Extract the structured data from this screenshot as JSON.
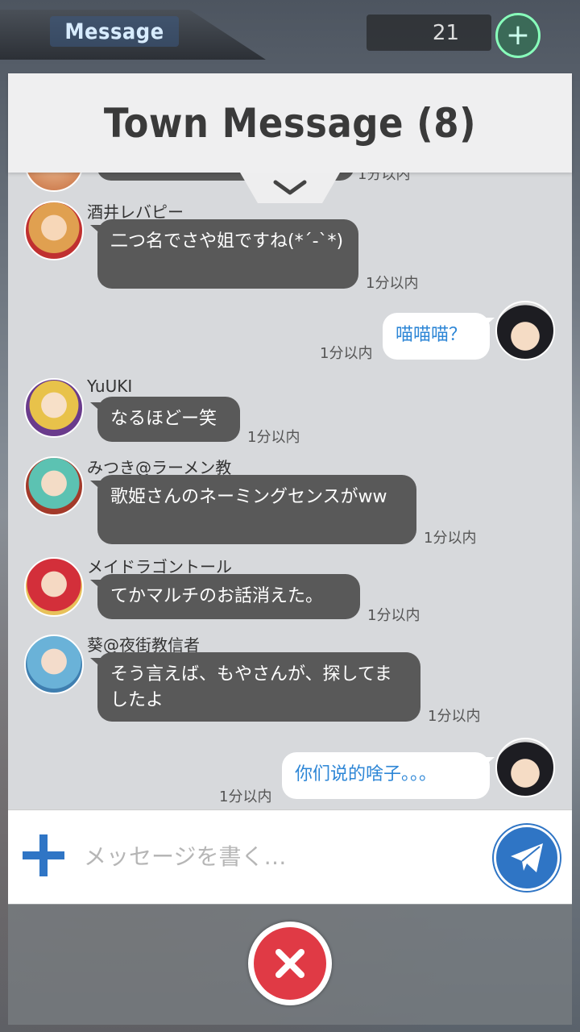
{
  "top_tab": {
    "label": "Message"
  },
  "top_counter": {
    "value": "21"
  },
  "header": {
    "title": "Town Message (8)"
  },
  "messages": [
    {
      "sender": "",
      "text": "",
      "time": "1分以内",
      "mine": false
    },
    {
      "sender": "酒井レバピー",
      "text": "二つ名でさや姐ですね(*´-`*)",
      "time": "1分以内",
      "mine": false
    },
    {
      "sender": "",
      "text": "喵喵喵？",
      "time": "1分以内",
      "mine": true
    },
    {
      "sender": "YuUKI",
      "text": "なるほどー笑",
      "time": "1分以内",
      "mine": false
    },
    {
      "sender": "みつき@ラーメン教",
      "text": "歌姫さんのネーミングセンスがww",
      "time": "1分以内",
      "mine": false
    },
    {
      "sender": "メイドラゴントール",
      "text": "てかマルチのお話消えた。",
      "time": "1分以内",
      "mine": false
    },
    {
      "sender": "葵@夜街教信者",
      "text": "そう言えば、もやさんが、探してましたよ",
      "time": "1分以内",
      "mine": false
    },
    {
      "sender": "",
      "text": "你们说的啥子。。。",
      "time": "1分以内",
      "mine": true
    }
  ],
  "input": {
    "placeholder": "メッセージを書く…"
  },
  "colors": {
    "accent": "#2f75c5",
    "bubble_other": "#595959",
    "bubble_mine_text": "#2d86d6",
    "close": "#e03a45"
  }
}
